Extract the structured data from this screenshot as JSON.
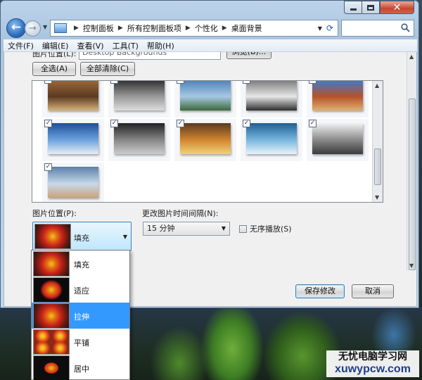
{
  "window": {
    "breadcrumb": [
      "控制面板",
      "所有控制面板项",
      "个性化",
      "桌面背景"
    ]
  },
  "menu": [
    "文件(F)",
    "编辑(E)",
    "查看(V)",
    "工具(T)",
    "帮助(H)"
  ],
  "picture_location": {
    "label": "图片位置(L):",
    "value": "Desktop Backgrounds",
    "browse_label": "浏览(B)..."
  },
  "buttons": {
    "select_all": "全选(A)",
    "clear_all": "全部清除(C)",
    "save": "保存修改",
    "cancel": "取消"
  },
  "gallery": {
    "thumbnails": [
      {
        "checked": true,
        "colors": [
          "#a06a3a",
          "#5b3a22",
          "#d7b27a"
        ]
      },
      {
        "checked": true,
        "colors": [
          "#2b2b2b",
          "#9a9a9a",
          "#dddddd"
        ]
      },
      {
        "checked": true,
        "colors": [
          "#4b7fb8",
          "#a7c8e4",
          "#3c6a3a"
        ]
      },
      {
        "checked": true,
        "colors": [
          "#777777",
          "#e6e6e6",
          "#2e2e2e"
        ]
      },
      {
        "checked": true,
        "colors": [
          "#3b7bd1",
          "#b5522c",
          "#e0b070"
        ]
      },
      {
        "checked": true,
        "colors": [
          "#1d4e9a",
          "#6ea4de",
          "#e8eef5"
        ]
      },
      {
        "checked": true,
        "colors": [
          "#222222",
          "#888888",
          "#cccccc"
        ]
      },
      {
        "checked": true,
        "colors": [
          "#5b3b1e",
          "#d2862f",
          "#f0d27a"
        ]
      },
      {
        "checked": true,
        "colors": [
          "#1e5f94",
          "#79b8de",
          "#e9f3fa"
        ]
      },
      {
        "checked": true,
        "colors": [
          "#f2f2f2",
          "#888888",
          "#3a3a3a"
        ]
      },
      {
        "checked": true,
        "colors": [
          "#5c7fa8",
          "#c7d9ea",
          "#caa27a"
        ]
      }
    ]
  },
  "picture_position": {
    "label": "图片位置(P):",
    "selected": "填充",
    "options": [
      "填充",
      "适应",
      "拉伸",
      "平铺",
      "居中"
    ],
    "highlighted": "拉伸"
  },
  "interval": {
    "label": "更改图片时间间隔(N):",
    "value": "15 分钟"
  },
  "shuffle": {
    "label": "无序播放(S)",
    "checked": false
  },
  "watermark": {
    "line1": "无忧电脑学习网",
    "line2": "xuwypcw.com"
  },
  "icons": [
    "back-arrow-icon",
    "forward-arrow-icon",
    "control-panel-icon",
    "refresh-icon",
    "search-icon",
    "minimize-icon",
    "maximize-icon",
    "close-icon",
    "dropdown-arrow-icon",
    "flower-icon"
  ]
}
